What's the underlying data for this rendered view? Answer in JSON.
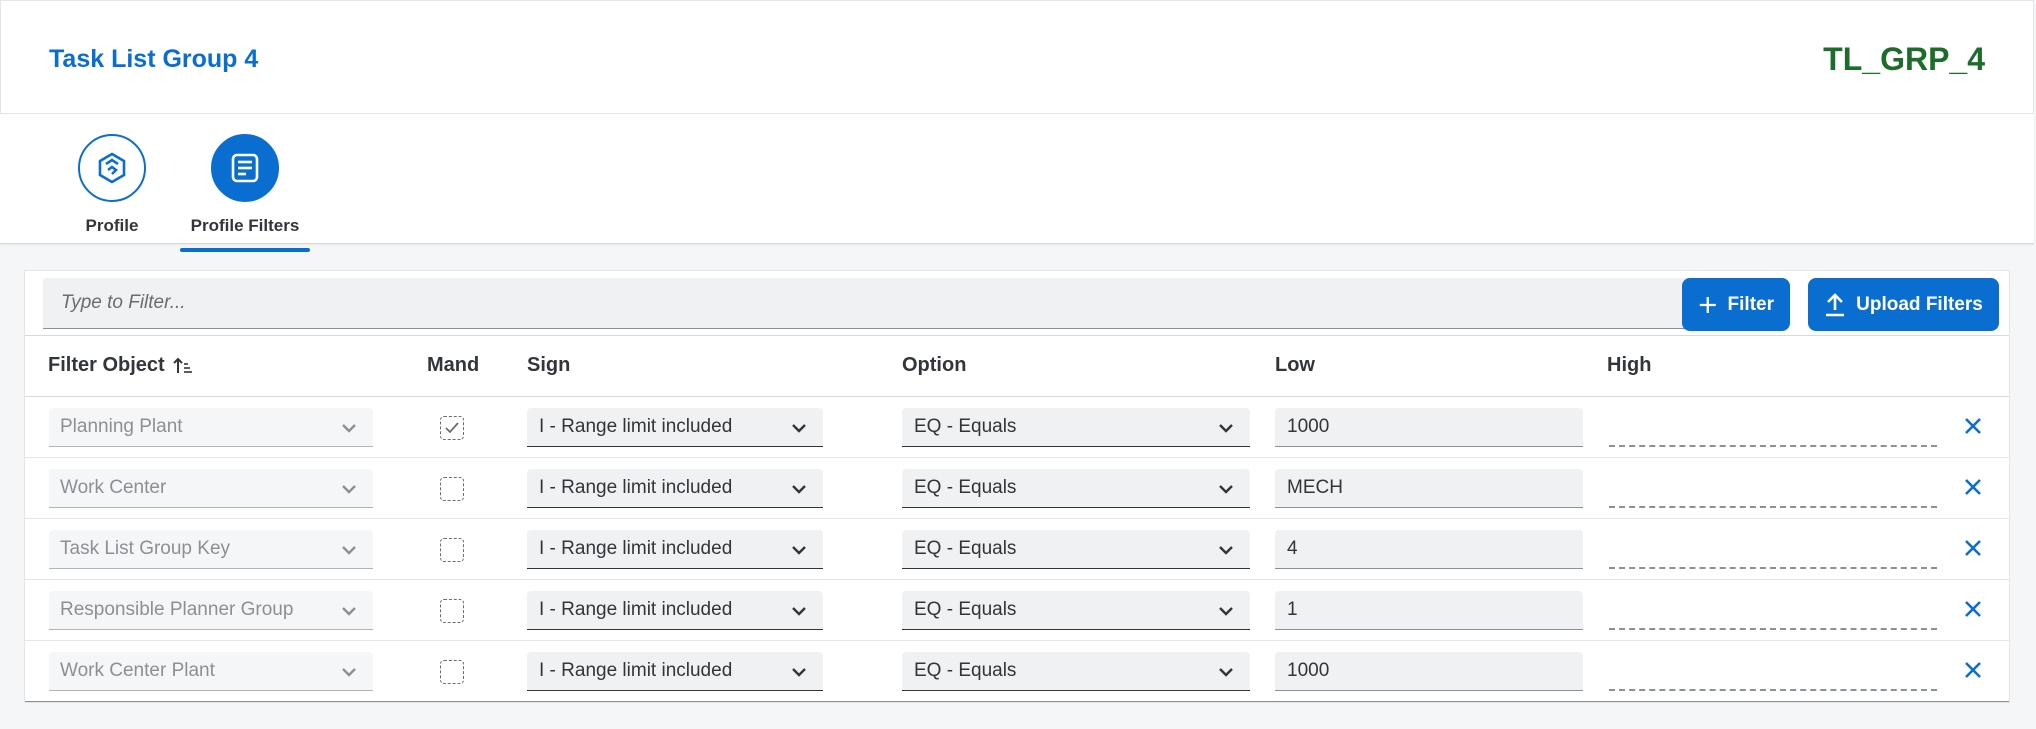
{
  "header": {
    "title": "Task List Group 4",
    "code": "TL_GRP_4"
  },
  "nav": {
    "tabs": [
      {
        "label": "Profile"
      },
      {
        "label": "Profile Filters"
      }
    ]
  },
  "toolbar": {
    "search_placeholder": "Type to Filter...",
    "filter_label": "Filter",
    "upload_label": "Upload Filters"
  },
  "table": {
    "columns": {
      "filter_object": "Filter Object",
      "mand": "Mand",
      "sign": "Sign",
      "option": "Option",
      "low": "Low",
      "high": "High"
    },
    "rows": [
      {
        "object": "Planning Plant",
        "mand": true,
        "sign": "I - Range limit included",
        "option": "EQ - Equals",
        "low": "1000",
        "high": ""
      },
      {
        "object": "Work Center",
        "mand": false,
        "sign": "I - Range limit included",
        "option": "EQ - Equals",
        "low": "MECH",
        "high": ""
      },
      {
        "object": "Task List Group Key",
        "mand": false,
        "sign": "I - Range limit included",
        "option": "EQ - Equals",
        "low": "4",
        "high": ""
      },
      {
        "object": "Responsible Planner Group",
        "mand": false,
        "sign": "I - Range limit included",
        "option": "EQ - Equals",
        "low": "1",
        "high": ""
      },
      {
        "object": "Work Center Plant",
        "mand": false,
        "sign": "I - Range limit included",
        "option": "EQ - Equals",
        "low": "1000",
        "high": ""
      }
    ]
  },
  "colors": {
    "accent": "#0a6ed1",
    "code_green": "#1d6d2a"
  }
}
